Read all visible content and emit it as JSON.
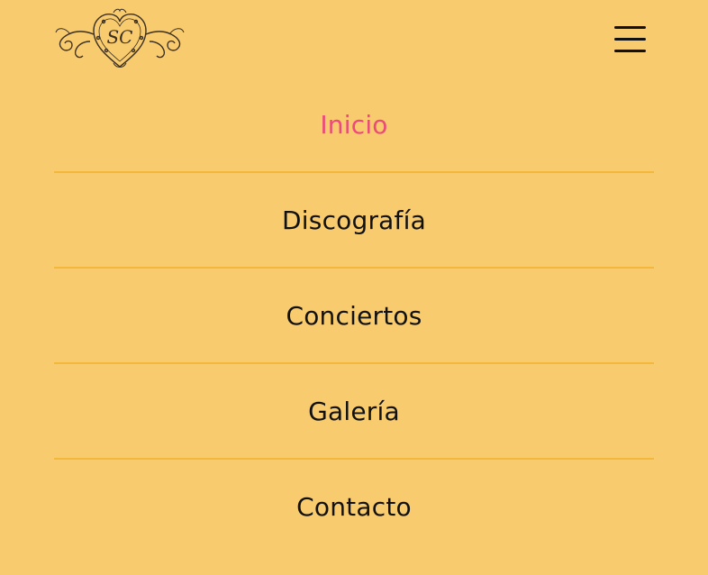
{
  "header": {
    "logo_monogram": "SC",
    "menu_icon": "hamburger-menu-icon"
  },
  "nav": {
    "items": [
      {
        "label": "Inicio",
        "active": true
      },
      {
        "label": "Discografía",
        "active": false
      },
      {
        "label": "Conciertos",
        "active": false
      },
      {
        "label": "Galería",
        "active": false
      },
      {
        "label": "Contacto",
        "active": false
      }
    ]
  },
  "colors": {
    "background": "#f8cb6f",
    "divider": "#f3b73a",
    "active": "#ec4a79",
    "text": "#111111"
  }
}
